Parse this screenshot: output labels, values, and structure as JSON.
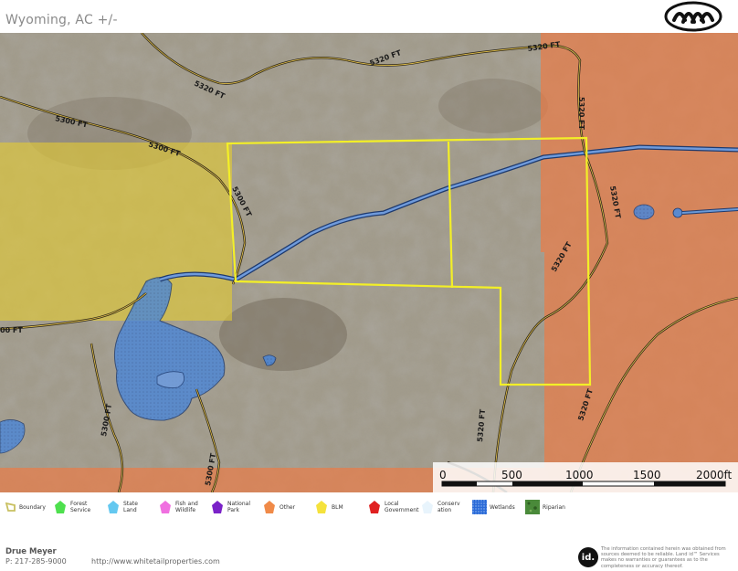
{
  "header": {
    "title": "Wyoming,  AC +/-"
  },
  "map": {
    "contour_labels": [
      "5320 FT",
      "5320 FT",
      "5320 FT",
      "5300 FT",
      "5300 FT",
      "5300 FT",
      "5320 FT",
      "5320 FT",
      "5320 FT",
      "5320 FT",
      "5320 FT",
      "5300 FT",
      "5300 FT",
      "5300 FT",
      "00 FT"
    ],
    "colors": {
      "boundary": "#f2ee2a",
      "blm": "#e9d23c",
      "other": "#ee7d4a",
      "wetlands": "#3f7fd6",
      "contour": "#2a2418"
    },
    "scale_bar": {
      "labels": [
        "0",
        "500",
        "1000",
        "1500",
        "2000ft"
      ]
    }
  },
  "legend": {
    "items": [
      {
        "label": "Boundary",
        "color": "#c8c060",
        "icon": "boundary-icon"
      },
      {
        "label": "Forest Service",
        "color": "#4ee04e",
        "icon": "forest-service-icon"
      },
      {
        "label": "State Land",
        "color": "#64c8f0",
        "icon": "state-land-icon"
      },
      {
        "label": "Fish and Wildlife",
        "color": "#f070e0",
        "icon": "fish-wildlife-icon"
      },
      {
        "label": "National Park",
        "color": "#7a22c8",
        "icon": "national-park-icon"
      },
      {
        "label": "Other",
        "color": "#f08a48",
        "icon": "other-icon"
      },
      {
        "label": "BLM",
        "color": "#f5e23c",
        "icon": "blm-icon"
      },
      {
        "label": "Local Government",
        "color": "#e02020",
        "icon": "local-government-icon"
      },
      {
        "label": "Conservation",
        "color": "#e8f4fc",
        "icon": "conservation-icon"
      },
      {
        "label": "Wetlands",
        "color": "#2a6ad8",
        "icon": "wetlands-icon"
      },
      {
        "label": "Riparian",
        "color": "#4a8a3a",
        "icon": "riparian-icon"
      }
    ]
  },
  "footer": {
    "name": "Drue Meyer",
    "phone": "P: 217-285-9000",
    "url": "http://www.whitetailproperties.com",
    "badge": "id.",
    "disclaimer": "The information contained herein was obtained from sources deemed to be reliable. Land id™ Services makes no warranties or guarantees as to the completeness or accuracy thereof."
  }
}
